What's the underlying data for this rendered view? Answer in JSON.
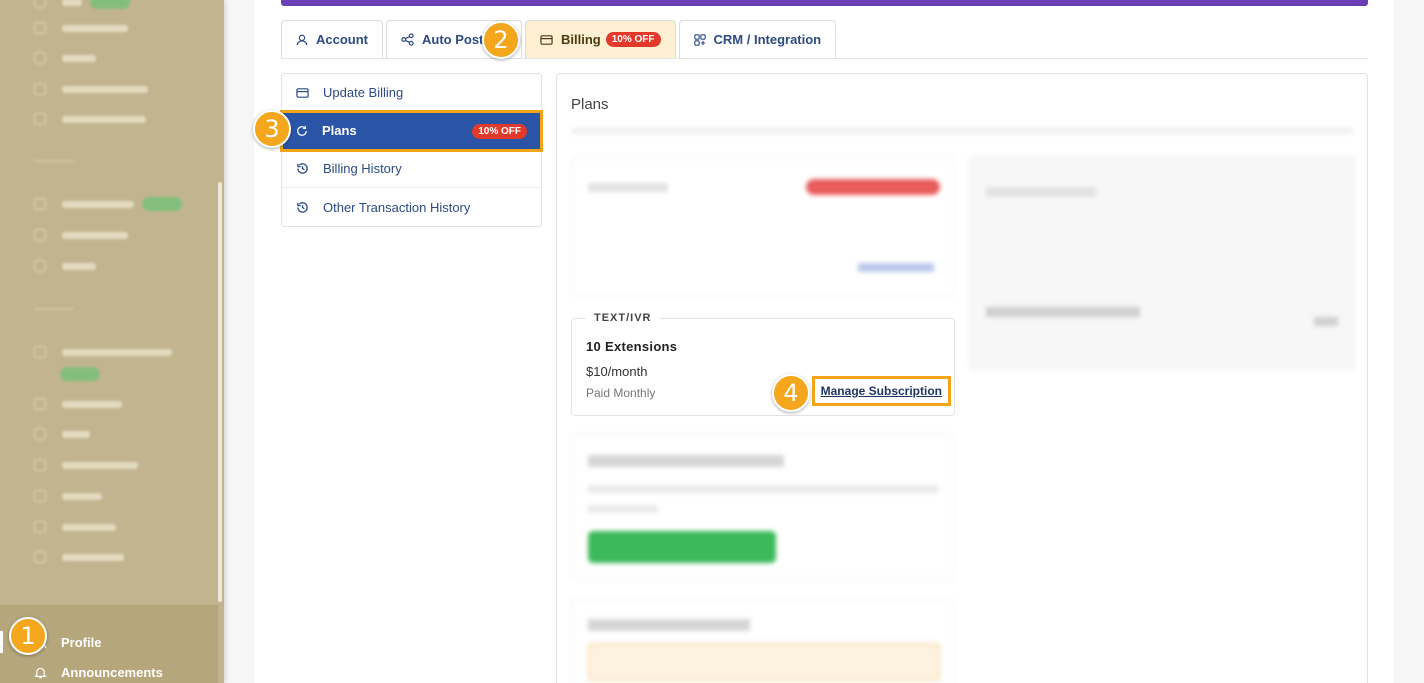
{
  "sidebar": {
    "items": [
      {
        "label": "Profile",
        "icon": "user-icon"
      },
      {
        "label": "Announcements",
        "icon": "bell-icon"
      }
    ]
  },
  "tabs": [
    {
      "label": "Account",
      "icon": "user-icon"
    },
    {
      "label": "Auto Posting",
      "icon": "share-icon"
    },
    {
      "label": "Billing",
      "icon": "card-icon",
      "badge": "10% OFF",
      "active": true
    },
    {
      "label": "CRM / Integration",
      "icon": "grid-icon"
    }
  ],
  "billing_menu": [
    {
      "label": "Update Billing",
      "icon": "card-icon"
    },
    {
      "label": "Plans",
      "icon": "refresh-icon",
      "badge": "10% OFF",
      "active": true
    },
    {
      "label": "Billing History",
      "icon": "history-icon"
    },
    {
      "label": "Other Transaction History",
      "icon": "history-icon"
    }
  ],
  "plans": {
    "title": "Plans",
    "subscription": {
      "label": "TEXT/IVR",
      "title": "10 Extensions",
      "price": "$10/month",
      "billing": "Paid Monthly",
      "action": "Manage Subscription"
    }
  },
  "steps": [
    "1",
    "2",
    "3",
    "4"
  ],
  "colors": {
    "sidebar_bg": "#c2b48e",
    "accent_bar": "#6a3fb5",
    "active_item": "#2a55a6",
    "highlight": "#f2a516",
    "badge": "#e3392a",
    "link": "#2c4a83"
  }
}
